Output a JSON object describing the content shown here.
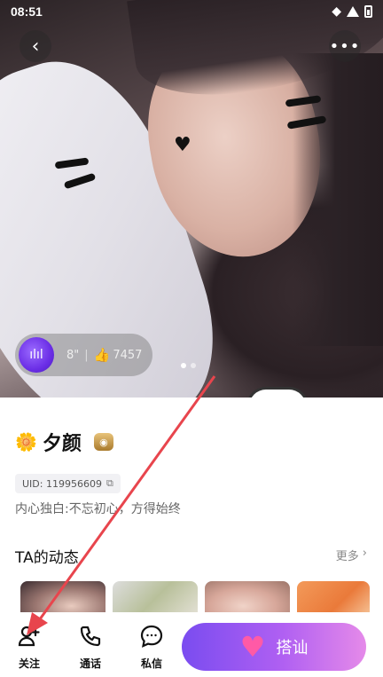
{
  "status_bar": {
    "time": "08:51"
  },
  "voice": {
    "duration": "8\"",
    "separator": "|",
    "likes": "7457"
  },
  "profile": {
    "name": "夕颜",
    "uid": "UID: 119956609",
    "bio_label": "内心独白:",
    "bio_text": "不忘初心，方得始终"
  },
  "moments": {
    "title": "TA的动态",
    "more_label": "更多"
  },
  "actions": {
    "follow_label": "关注",
    "call_label": "通话",
    "message_label": "私信",
    "greet_label": "搭讪"
  },
  "colors": {
    "accent_gradient_start": "#7a4cf0",
    "accent_gradient_end": "#e58ae9",
    "annotation_arrow": "#e8454d"
  },
  "carousel": {
    "total": 2,
    "active_index": 0
  }
}
